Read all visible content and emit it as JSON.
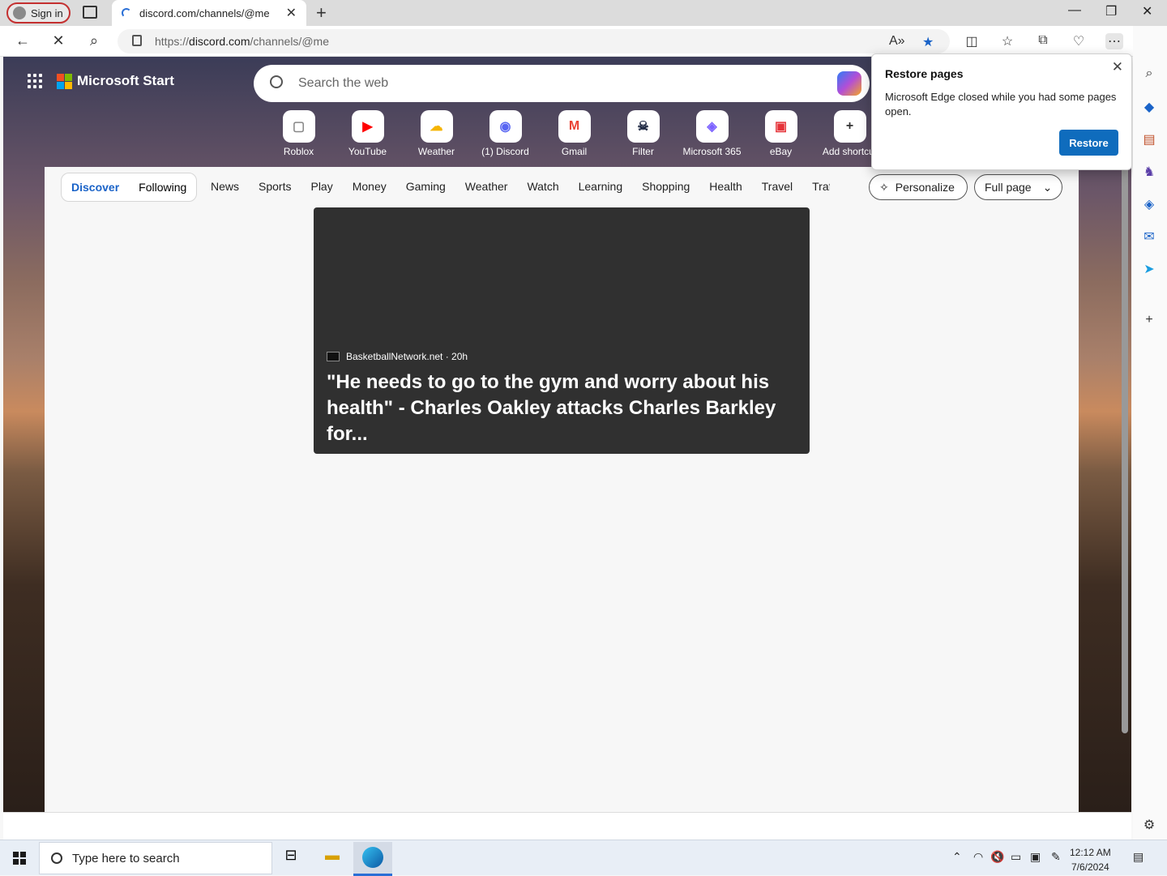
{
  "browser": {
    "signin_label": "Sign in",
    "tab_title": "discord.com/channels/@me",
    "url_prefix": "https://",
    "url_host": "discord.com",
    "url_path": "/channels/@me"
  },
  "start": {
    "brand": "Microsoft Start",
    "search_placeholder": "Search the web",
    "shortcuts": [
      {
        "label": "Roblox",
        "icon": "roblox-icon",
        "glyph": "▢",
        "color": "#888888"
      },
      {
        "label": "YouTube",
        "icon": "youtube-icon",
        "glyph": "▶",
        "color": "#ff0000"
      },
      {
        "label": "Weather",
        "icon": "weather-icon",
        "glyph": "☁",
        "color": "#f5b400"
      },
      {
        "label": "(1) Discord",
        "icon": "discord-icon",
        "glyph": "◉",
        "color": "#5865f2"
      },
      {
        "label": "Gmail",
        "icon": "gmail-icon",
        "glyph": "M",
        "color": "#ea4335"
      },
      {
        "label": "Filter",
        "icon": "filter-icon",
        "glyph": "☠",
        "color": "#1b2540"
      },
      {
        "label": "Microsoft 365",
        "icon": "m365-icon",
        "glyph": "◈",
        "color": "#7b61ff"
      },
      {
        "label": "eBay",
        "icon": "ebay-icon",
        "glyph": "▣",
        "color": "#e53238"
      },
      {
        "label": "Add shortcut",
        "icon": "plus-icon",
        "glyph": "+",
        "color": "#333333"
      }
    ],
    "tabs": {
      "discover": "Discover",
      "following": "Following"
    },
    "categories": [
      "News",
      "Sports",
      "Play",
      "Money",
      "Gaming",
      "Weather",
      "Watch",
      "Learning",
      "Shopping",
      "Health",
      "Travel",
      "Traffi"
    ],
    "personalize_label": "Personalize",
    "fullpage_label": "Full page",
    "card": {
      "source": "BasketballNetwork.net · 20h",
      "headline": "\"He needs to go to the gym and worry about his health\" - Charles Oakley attacks Charles Barkley for..."
    }
  },
  "popup": {
    "title": "Restore pages",
    "message": "Microsoft Edge closed while you had some pages open.",
    "button": "Restore"
  },
  "taskbar": {
    "search_placeholder": "Type here to search",
    "time": "12:12 AM",
    "date": "7/6/2024"
  },
  "colors": {
    "accent": "#0f6cbd",
    "active_tab": "#1a63c8"
  }
}
